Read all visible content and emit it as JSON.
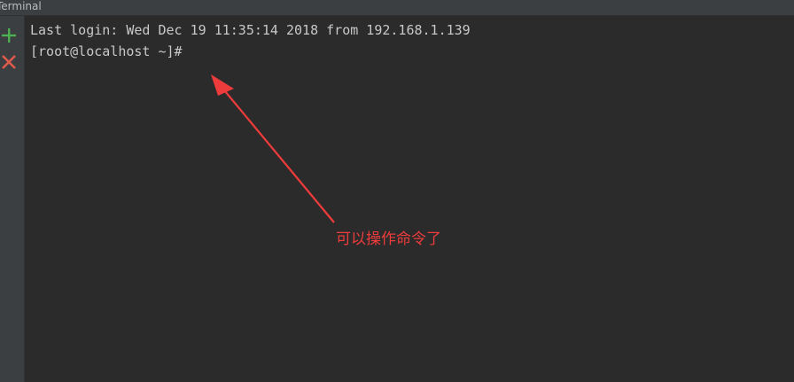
{
  "window": {
    "title": "Terminal"
  },
  "sidebar": {
    "new_session_icon": "plus-icon",
    "close_session_icon": "close-icon",
    "colors": {
      "plus": "#4caf50",
      "close": "#e05a4e"
    }
  },
  "terminal": {
    "lines": [
      "Last login: Wed Dec 19 11:35:14 2018 from 192.168.1.139",
      "[root@localhost ~]#"
    ]
  },
  "annotation": {
    "text": "可以操作命令了",
    "color": "#ee3b3b"
  }
}
